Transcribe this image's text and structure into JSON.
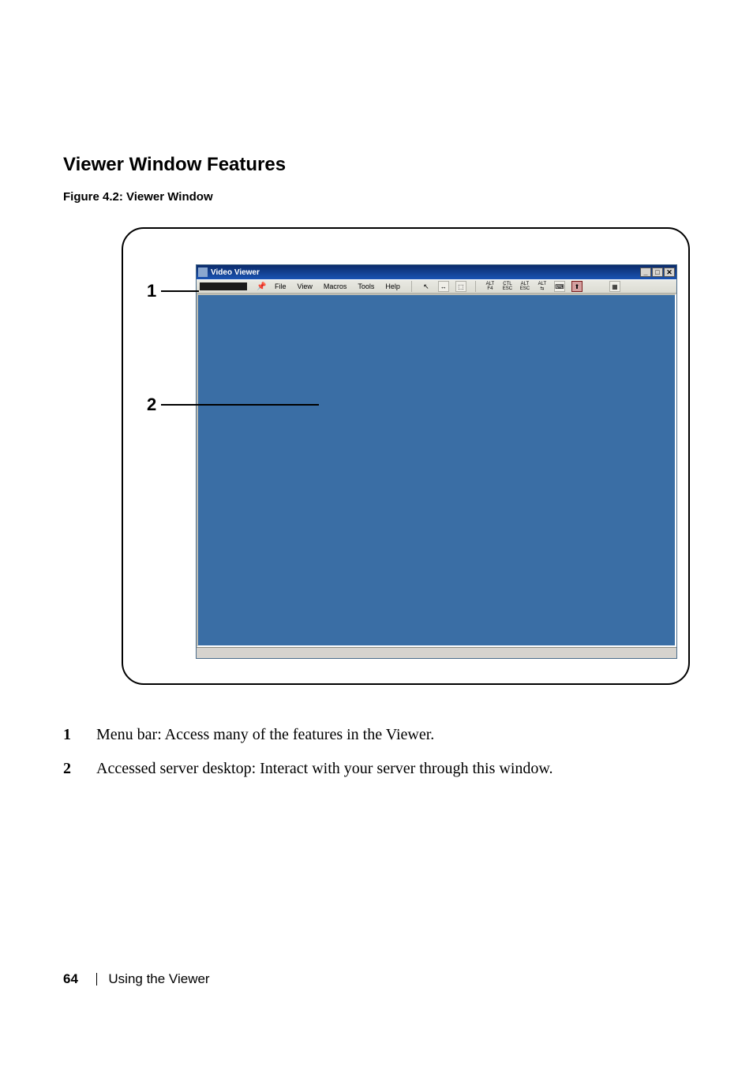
{
  "section_title": "Viewer Window Features",
  "figure_caption": "Figure 4.2: Viewer Window",
  "callouts": {
    "c1": "1",
    "c2": "2"
  },
  "viewer": {
    "window_title": "Video Viewer",
    "win_min": "_",
    "win_max": "□",
    "win_close": "✕",
    "menu": {
      "file": "File",
      "view": "View",
      "macros": "Macros",
      "tools": "Tools",
      "help": "Help"
    },
    "toolbar_labels": {
      "altf4": "ALT\nF4",
      "ctlesc": "CTL\nESC",
      "altesc": "ALT\nESC",
      "alttab": "ALT\n⇆"
    }
  },
  "descriptions": [
    {
      "num": "1",
      "text": "Menu bar: Access many of the features in the Viewer."
    },
    {
      "num": "2",
      "text": "Accessed server desktop: Interact with your server through this window."
    }
  ],
  "footer": {
    "page_number": "64",
    "section": "Using the Viewer"
  }
}
